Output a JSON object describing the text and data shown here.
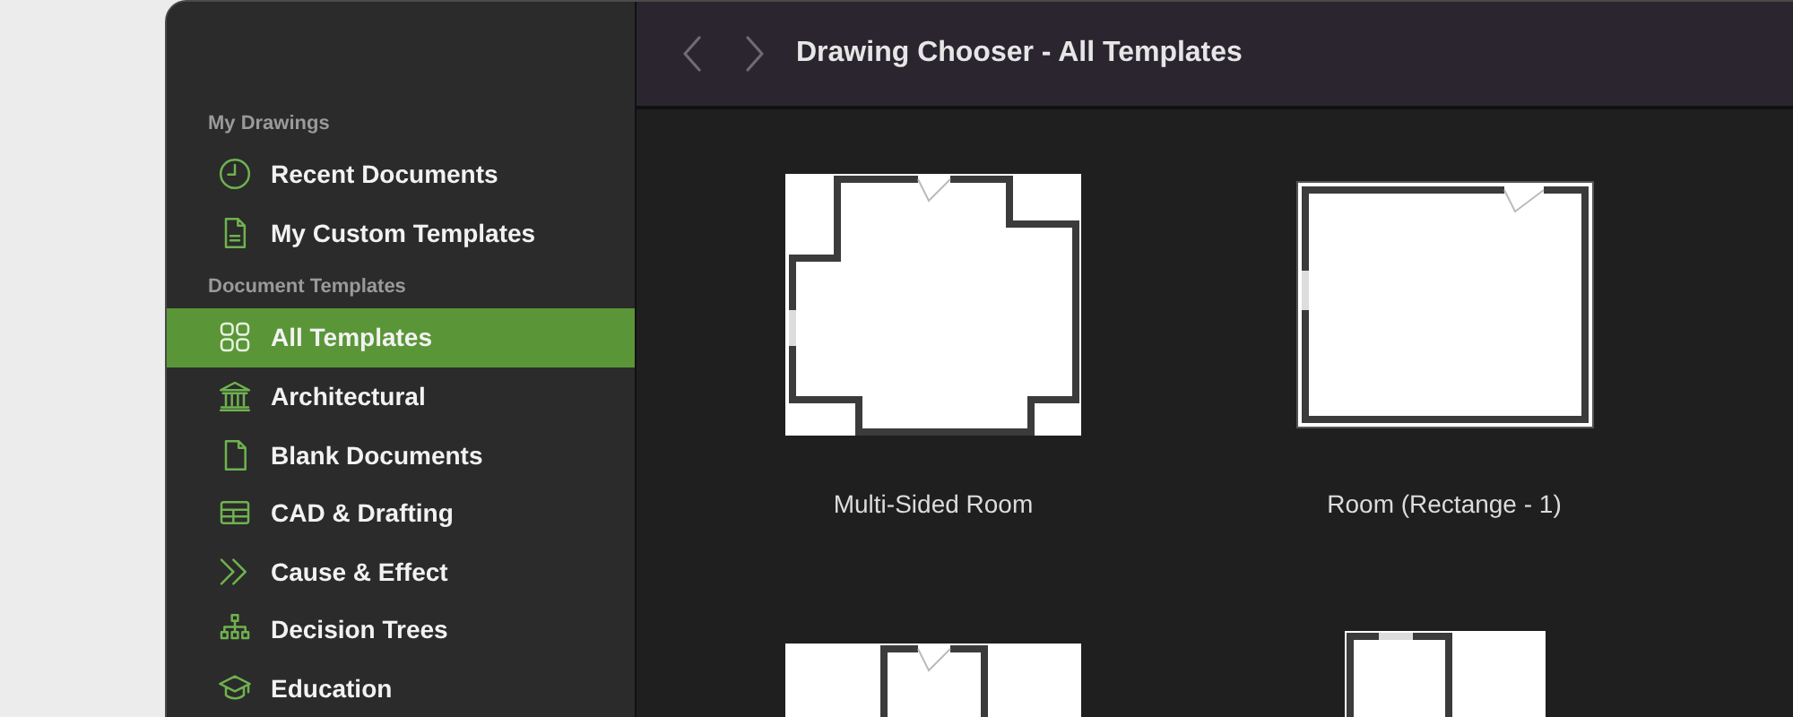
{
  "toolbar": {
    "title": "Drawing Chooser - All Templates"
  },
  "sidebar": {
    "sections": [
      {
        "title": "My Drawings",
        "items": [
          {
            "label": "Recent Documents",
            "kind": "clock",
            "selected": false
          },
          {
            "label": "My Custom Templates",
            "kind": "document",
            "selected": false
          }
        ]
      },
      {
        "title": "Document Templates",
        "items": [
          {
            "label": "All Templates",
            "kind": "grid",
            "selected": true
          },
          {
            "label": "Architectural",
            "kind": "building",
            "selected": false
          },
          {
            "label": "Blank Documents",
            "kind": "page",
            "selected": false
          },
          {
            "label": "CAD & Drafting",
            "kind": "table",
            "selected": false
          },
          {
            "label": "Cause & Effect",
            "kind": "chevrons",
            "selected": false
          },
          {
            "label": "Decision Trees",
            "kind": "tree",
            "selected": false
          },
          {
            "label": "Education",
            "kind": "cap",
            "selected": false
          }
        ]
      }
    ]
  },
  "templates": [
    {
      "name": "Multi-Sided Room",
      "kind": "multi-sided"
    },
    {
      "name": "Room (Rectange - 1)",
      "kind": "rectangle"
    },
    {
      "kind": "t-shape"
    },
    {
      "kind": "l-shape"
    }
  ]
}
